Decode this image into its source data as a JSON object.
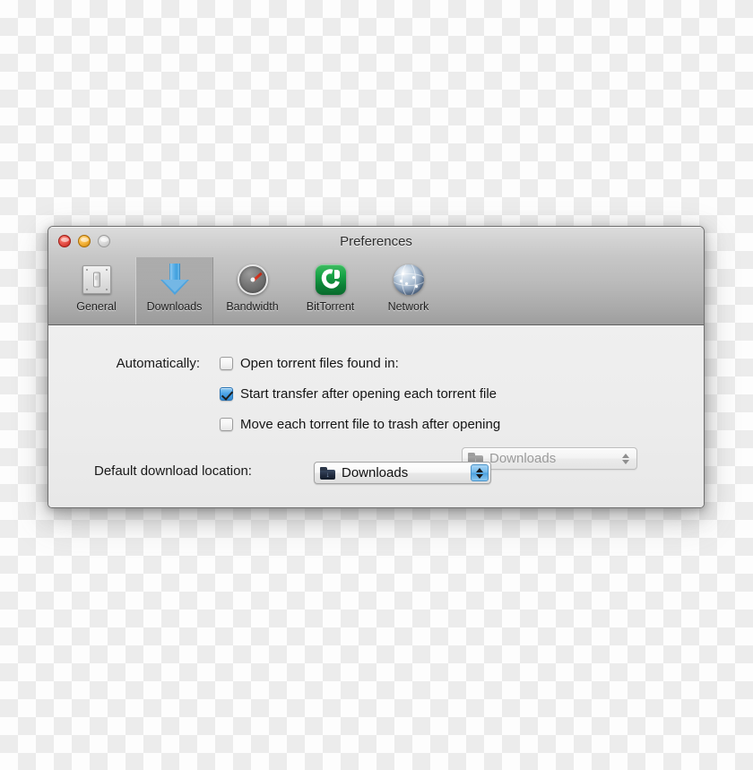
{
  "window": {
    "title": "Preferences",
    "controls": {
      "close": "close-button",
      "minimize": "minimize-button",
      "zoom": "zoom-button"
    }
  },
  "toolbar": {
    "tabs": [
      {
        "label": "General",
        "icon": "switch-plate-icon",
        "selected": false
      },
      {
        "label": "Downloads",
        "icon": "down-arrow-icon",
        "selected": true
      },
      {
        "label": "Bandwidth",
        "icon": "gauge-icon",
        "selected": false
      },
      {
        "label": "BitTorrent",
        "icon": "bittorrent-icon",
        "selected": false
      },
      {
        "label": "Network",
        "icon": "globe-icon",
        "selected": false
      }
    ]
  },
  "main": {
    "automatically_label": "Automatically:",
    "options": [
      {
        "label": "Open torrent files found in:",
        "checked": false
      },
      {
        "label": "Start transfer after opening each torrent file",
        "checked": true
      },
      {
        "label": "Move each torrent file to trash after opening",
        "checked": false
      }
    ],
    "found_in_popup": {
      "value": "Downloads",
      "icon": "downloads-folder-icon",
      "enabled": false
    },
    "default_location_label": "Default download location:",
    "default_location_popup": {
      "value": "Downloads",
      "icon": "downloads-folder-icon",
      "enabled": true
    }
  },
  "colors": {
    "accent": "#3f9fdd",
    "checkbox_on": "#2f8ad4",
    "bittorrent_green": "#19a447",
    "gauge_needle": "#e43b26",
    "close": "#e8524a",
    "minimize": "#f5b43a",
    "zoom": "#d8d8d8"
  }
}
